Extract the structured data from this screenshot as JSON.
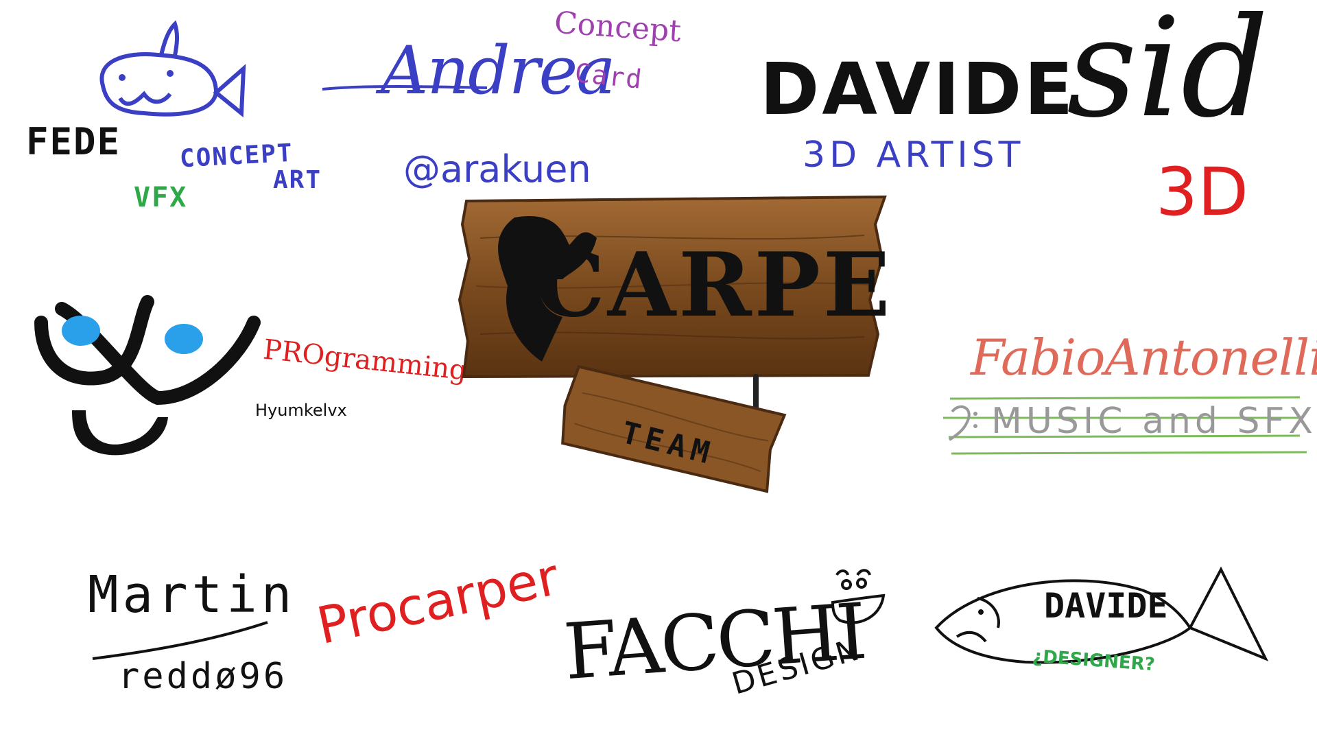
{
  "canvas": {
    "background": "#ffffff"
  },
  "colors": {
    "black": "#111111",
    "blue": "#3b3fc4",
    "green": "#2fa84a",
    "purple": "#a040b0",
    "red": "#e02020",
    "salmon": "#e06a5a",
    "light_green": "#7dbb5a",
    "eye_blue": "#2aa0ea",
    "wood_dark": "#4a2a10",
    "wood_mid": "#7a4a1e",
    "wood_light": "#a26a34"
  },
  "sign": {
    "title": "CARPE",
    "subtitle": "TEAM"
  },
  "credits": {
    "fede": {
      "name": "FEDE",
      "role": "VFX"
    },
    "concept_art": {
      "text_line1": "CONCEPT",
      "text_line2": "ART"
    },
    "andrea": {
      "name": "Andrea",
      "handle": "@arakuen"
    },
    "concept_card": {
      "line1": "Concept",
      "line2": "Card"
    },
    "davide_3d": {
      "name": "DAVIDE",
      "role": "3D ARTIST"
    },
    "sid": {
      "name": "sid",
      "role": "3D"
    },
    "programming": {
      "role": "PROgramming",
      "handle": "Hyumkelvx"
    },
    "fabio": {
      "name": "FabioAntonelli",
      "role": "MUSIC and SFX"
    },
    "martin": {
      "name": "Martin",
      "handle": "reddø96"
    },
    "procarper": {
      "text": "Procarper"
    },
    "facchi": {
      "name": "FACCHI",
      "role": "DESIGN"
    },
    "davide_designer": {
      "name": "DAVIDE",
      "role": "¿DESIGNER?"
    }
  },
  "icons": [
    "whale-doodle-icon",
    "face-doodle-icon",
    "smiley-doodle-icon",
    "fish-doodle-icon",
    "bass-clef-icon"
  ]
}
